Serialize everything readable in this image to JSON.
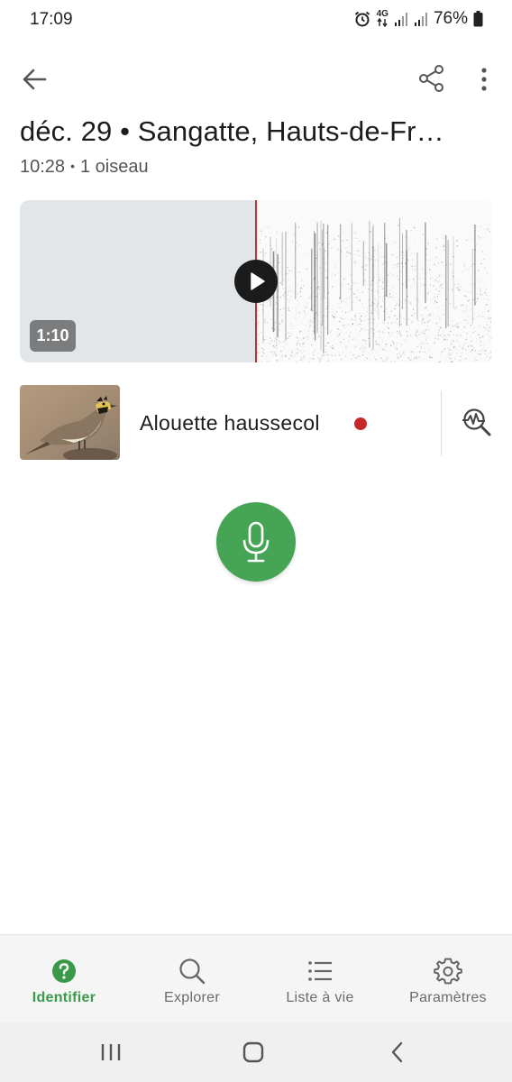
{
  "status_bar": {
    "time": "17:09",
    "network": "4G",
    "battery": "76%",
    "icons": [
      "alarm-icon",
      "network-4g-icon",
      "signal-icon",
      "signal-icon",
      "battery-icon"
    ]
  },
  "app_bar": {
    "icons": [
      "arrow-back-icon",
      "share-icon",
      "more-vert-icon"
    ]
  },
  "header": {
    "title": "déc. 29 • Sangatte, Hauts-de-Fr…",
    "time": "10:28",
    "separator": "•",
    "bird_count": "1 oiseau"
  },
  "recording": {
    "duration": "1:10",
    "progress": 0.5,
    "icons": [
      "play-icon"
    ]
  },
  "species": {
    "name": "Alouette haussecol",
    "status_color": "#c62828",
    "icons": [
      "bird-photo",
      "analyze-waveform-search-icon"
    ]
  },
  "record_button": {
    "color": "#46a455",
    "icon": "mic-icon"
  },
  "bottom_nav": {
    "items": [
      {
        "label": "Identifier",
        "icon": "help-circle-icon",
        "active": true
      },
      {
        "label": "Explorer",
        "icon": "search-icon",
        "active": false
      },
      {
        "label": "Liste à vie",
        "icon": "list-icon",
        "active": false
      },
      {
        "label": "Paramètres",
        "icon": "gear-icon",
        "active": false
      }
    ]
  },
  "system_nav": {
    "icons": [
      "recent-apps-icon",
      "home-icon",
      "back-icon"
    ]
  },
  "colors": {
    "accent": "#46a455",
    "active_nav": "#3a9a4a",
    "playhead": "#c0302d"
  }
}
